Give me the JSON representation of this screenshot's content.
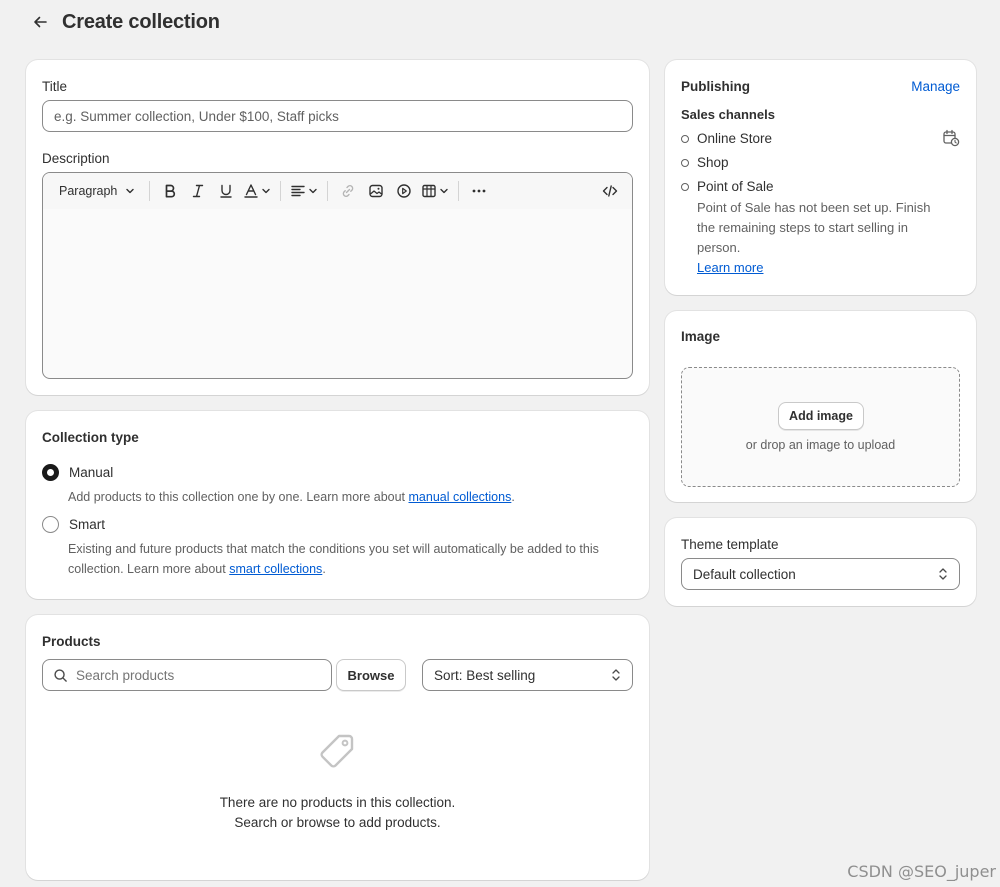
{
  "header": {
    "title": "Create collection",
    "back_icon": "arrow-left-icon"
  },
  "details": {
    "title_label": "Title",
    "title_placeholder": "e.g. Summer collection, Under $100, Staff picks",
    "title_value": "",
    "description_label": "Description",
    "toolbar": {
      "paragraph_label": "Paragraph",
      "buttons": [
        "bold-icon",
        "italic-icon",
        "underline-icon",
        "text-color-icon",
        "align-icon",
        "link-icon",
        "image-icon",
        "video-icon",
        "table-icon",
        "more-icon",
        "code-icon"
      ]
    }
  },
  "collection_type": {
    "heading": "Collection type",
    "options": [
      {
        "label": "Manual",
        "selected": true,
        "help": "Add products to this collection one by one. Learn more about ",
        "link": "manual collections",
        "suffix": "."
      },
      {
        "label": "Smart",
        "selected": false,
        "help_line1": "Existing and future products that match the conditions you set will automatically be added to this",
        "help_line2": "collection. Learn more about ",
        "link": "smart collections",
        "suffix": "."
      }
    ]
  },
  "products": {
    "heading": "Products",
    "search_placeholder": "Search products",
    "browse_label": "Browse",
    "sort_label": "Sort: Best selling",
    "empty_line1": "There are no products in this collection.",
    "empty_line2": "Search or browse to add products."
  },
  "publishing": {
    "heading": "Publishing",
    "manage_label": "Manage",
    "sales_channels_label": "Sales channels",
    "channels": [
      "Online Store",
      "Shop",
      "Point of Sale"
    ],
    "pos_note_line1": "Point of Sale has not been set up. Finish",
    "pos_note_line2": "the remaining steps to start selling in",
    "pos_note_line3": "person.",
    "learn_more": "Learn more"
  },
  "image": {
    "heading": "Image",
    "add_label": "Add image",
    "drop_hint": "or drop an image to upload"
  },
  "theme_template": {
    "label": "Theme template",
    "value": "Default collection"
  },
  "watermark": "CSDN @SEO_juper",
  "colors": {
    "background": "#f1f1f1",
    "card": "#ffffff",
    "link": "#005bd3",
    "text": "#303030",
    "muted": "#616161"
  }
}
